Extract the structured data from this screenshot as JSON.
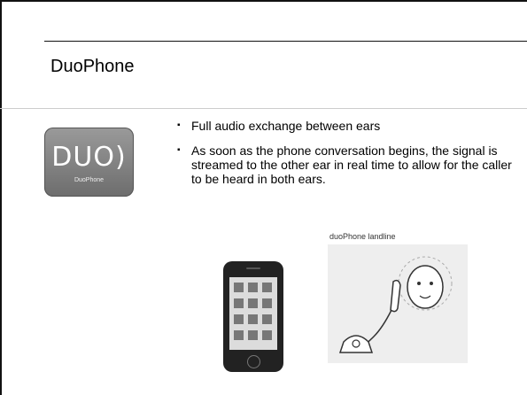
{
  "slide": {
    "title": "DuoPhone",
    "app_icon": {
      "logo_text": "DUO",
      "logo_glyph": ")",
      "sub_text": "DuoPhone",
      "icon_name": "duophone-app-icon"
    },
    "bullets": [
      "Full audio exchange between ears",
      "As soon as the phone conversation begins, the signal is streamed to the other ear in real time to allow for the caller to be heard in both ears."
    ],
    "images": {
      "phone_label": "",
      "landline_label": "duoPhone landline"
    }
  }
}
